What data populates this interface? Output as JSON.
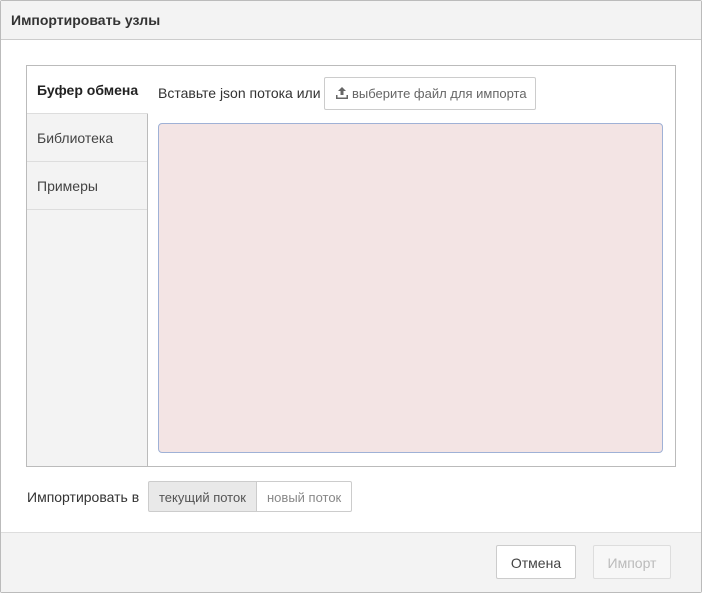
{
  "dialog": {
    "title": "Импортировать узлы"
  },
  "tabs": [
    {
      "label": "Буфер обмена",
      "active": true
    },
    {
      "label": "Библиотека",
      "active": false
    },
    {
      "label": "Примеры",
      "active": false
    }
  ],
  "clipboard": {
    "paste_label": "Вставьте json потока или",
    "file_button_label": "выберите файл для импорта",
    "file_button_icon": "upload-icon",
    "json_value": ""
  },
  "import_target": {
    "label": "Импортировать в",
    "options": [
      {
        "label": "текущий поток",
        "selected": true
      },
      {
        "label": "новый поток",
        "selected": false
      }
    ]
  },
  "footer": {
    "cancel_label": "Отмена",
    "import_label": "Импорт",
    "import_enabled": false
  },
  "colors": {
    "textarea_bg": "#f3e4e4",
    "textarea_border": "#9fb1d6"
  }
}
